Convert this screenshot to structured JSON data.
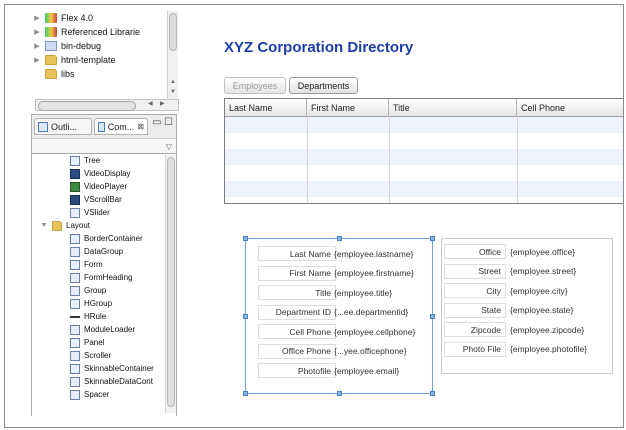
{
  "package_explorer": {
    "items": [
      {
        "label": "Flex 4.0",
        "icon": "flex-sdk-icon"
      },
      {
        "label": "Referenced Librarie",
        "icon": "library-icon"
      },
      {
        "label": "bin-debug",
        "icon": "bin-folder-icon"
      },
      {
        "label": "html-template",
        "icon": "folder-icon"
      },
      {
        "label": "libs",
        "icon": "folder-icon"
      }
    ]
  },
  "panel_tabs": {
    "outline": "Outli...",
    "components": "Com...",
    "components_close": "⊠",
    "minimize": "▭",
    "maximize": "☐"
  },
  "components": {
    "items": [
      {
        "label": "Tree",
        "indent": 2
      },
      {
        "label": "VideoDisplay",
        "indent": 2
      },
      {
        "label": "VideoPlayer",
        "indent": 2
      },
      {
        "label": "VScrollBar",
        "indent": 2
      },
      {
        "label": "VSlider",
        "indent": 2
      },
      {
        "label": "Layout",
        "indent": 0,
        "expanded": true
      },
      {
        "label": "BorderContainer",
        "indent": 2
      },
      {
        "label": "DataGroup",
        "indent": 2
      },
      {
        "label": "Form",
        "indent": 2
      },
      {
        "label": "FormHeading",
        "indent": 2
      },
      {
        "label": "Group",
        "indent": 2
      },
      {
        "label": "HGroup",
        "indent": 2
      },
      {
        "label": "HRule",
        "indent": 2
      },
      {
        "label": "ModuleLoader",
        "indent": 2
      },
      {
        "label": "Panel",
        "indent": 2
      },
      {
        "label": "Scroller",
        "indent": 2
      },
      {
        "label": "SkinnableContainer",
        "indent": 2
      },
      {
        "label": "SkinnableDataCont",
        "indent": 2
      },
      {
        "label": "Spacer",
        "indent": 2
      }
    ]
  },
  "app": {
    "title": "XYZ Corporation Directory",
    "buttons": {
      "employees": "Employees",
      "departments": "Departments"
    },
    "grid": {
      "columns": [
        "Last Name",
        "First Name",
        "Title",
        "Cell Phone"
      ],
      "row_count": 5
    },
    "form_left": [
      {
        "label": "Last Name",
        "value": "{employee.lastname}"
      },
      {
        "label": "First Name",
        "value": "{employee.firstname}"
      },
      {
        "label": "Title",
        "value": "{employee.title}"
      },
      {
        "label": "Department ID",
        "value": "{...ee.departmentid}"
      },
      {
        "label": "Cell Phone",
        "value": "{employee.cellphone}"
      },
      {
        "label": "Office Phone",
        "value": "{...yee.officephone}"
      },
      {
        "label": "Photofile",
        "value": "{employee.email}"
      }
    ],
    "form_right": [
      {
        "label": "Office",
        "value": "{employee.office}"
      },
      {
        "label": "Street",
        "value": "{employee.street}"
      },
      {
        "label": "City",
        "value": "{employee.city}"
      },
      {
        "label": "State",
        "value": "{employee.state}"
      },
      {
        "label": "Zipcode",
        "value": "{employee.zipcode}"
      },
      {
        "label": "Photo File",
        "value": "{employee.photofile}"
      }
    ]
  },
  "colors": {
    "title": "#1d3ea8",
    "selection": "#6fa3dd",
    "row_alt": "#eef3fb"
  }
}
